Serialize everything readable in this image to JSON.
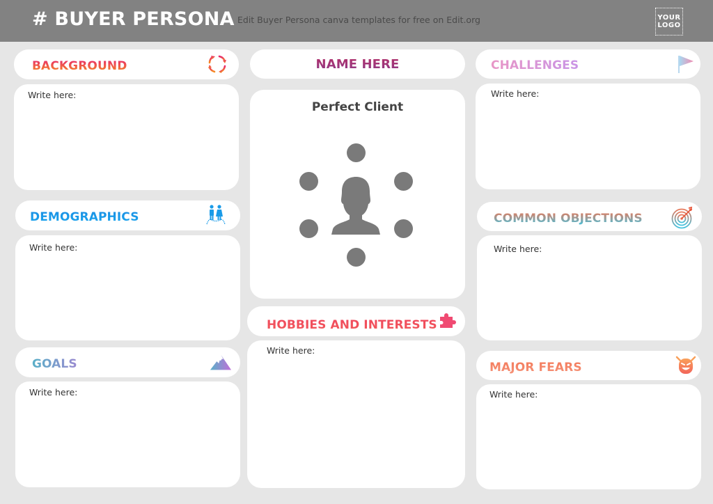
{
  "header": {
    "title": "# BUYER PERSONA",
    "subtitle": "Edit Buyer Persona canva templates for free on Edit.org",
    "logo_line1": "YOUR",
    "logo_line2": "LOGO"
  },
  "placeholder_text": "Write here:",
  "center": {
    "name_label": "NAME HERE",
    "client_title": "Perfect Client",
    "avatar_icon": "person-network-icon"
  },
  "sections": {
    "background": {
      "label": "BACKGROUND",
      "body": "Write here:",
      "icon": "refresh-arrows-icon",
      "colors": [
        "#e8276e",
        "#f7911e"
      ]
    },
    "demographics": {
      "label": "DEMOGRAPHICS",
      "body": "Write here:",
      "icon": "couple-icon",
      "colors": [
        "#1a8fe3",
        "#1aa6ef"
      ]
    },
    "goals": {
      "label": "GOALS",
      "body": "Write here:",
      "icon": "mountain-icon",
      "colors": [
        "#5ab0c8",
        "#b06fd1"
      ]
    },
    "hobbies": {
      "label": "HOBBIES AND INTERESTS",
      "body": "Write here:",
      "icon": "puzzle-icon",
      "colors": [
        "#f0485e",
        "#f25a5a"
      ]
    },
    "challenges": {
      "label": "CHALLENGES",
      "body": "Write here:",
      "icon": "flag-icon",
      "colors": [
        "#e896c6",
        "#c994e6"
      ]
    },
    "objections": {
      "label": "COMMON OBJECTIONS",
      "body": "Write here:",
      "icon": "target-icon",
      "colors": [
        "#e8795a",
        "#41c3e0"
      ]
    },
    "fears": {
      "label": "MAJOR FEARS",
      "body": "Write here:",
      "icon": "monster-face-icon",
      "colors": [
        "#f47a5a",
        "#f5947a"
      ]
    }
  }
}
